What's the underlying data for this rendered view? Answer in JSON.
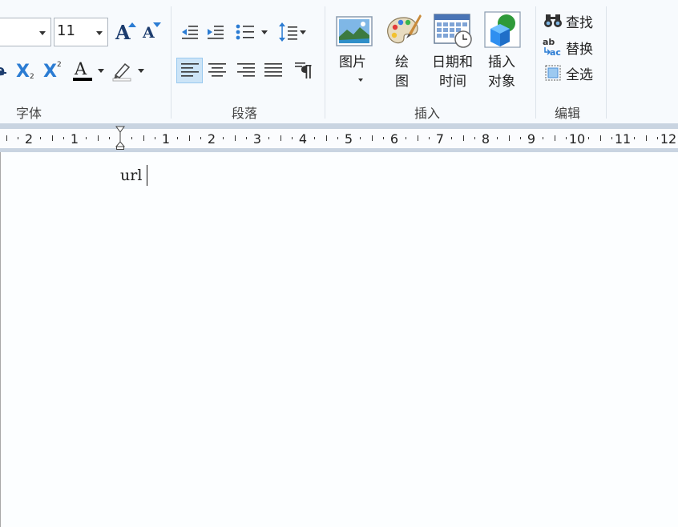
{
  "font_group": {
    "label": "字体",
    "font_name_value": "",
    "font_size_value": "11",
    "grow_font_glyph": "A",
    "shrink_font_glyph": "A",
    "strike_glyph": "e",
    "subscript_glyph": "X",
    "superscript_glyph": "X",
    "subscript_mark": "2",
    "superscript_mark": "2",
    "font_color_glyph": "A"
  },
  "paragraph_group": {
    "label": "段落"
  },
  "insert_group": {
    "label": "插入",
    "picture_label": "图片",
    "draw_label_1": "绘",
    "draw_label_2": "图",
    "datetime_label_1": "日期和",
    "datetime_label_2": "时间",
    "object_label_1": "插入",
    "object_label_2": "对象"
  },
  "edit_group": {
    "label": "编辑",
    "find_label": "查找",
    "replace_label": "替换",
    "select_all_label": "全选"
  },
  "ruler": {
    "left_numbers": [
      "2",
      "1"
    ],
    "right_numbers": [
      "1",
      "2",
      "3",
      "4",
      "5",
      "6",
      "7",
      "8",
      "9",
      "10",
      "11",
      "12"
    ]
  },
  "document": {
    "text": "url"
  },
  "colors": {
    "accent": "#2b7cd3",
    "active_button": "#cce4f7",
    "ribbon_bg": "#f7fafd",
    "ruler_bg": "#c9d4e1"
  }
}
